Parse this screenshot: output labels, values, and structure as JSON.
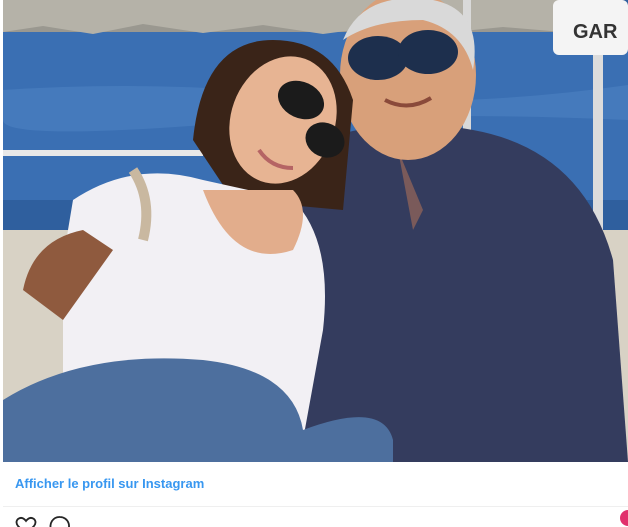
{
  "post": {
    "image_alt": "Woman and man in sunglasses on a boat",
    "sign_text": "GAR",
    "profile_link": "Afficher le profil sur Instagram"
  },
  "actions": {
    "like_icon": "heart-icon",
    "comment_icon": "comment-icon"
  },
  "colors": {
    "link": "#3897f0",
    "accent": "#e1306c"
  }
}
